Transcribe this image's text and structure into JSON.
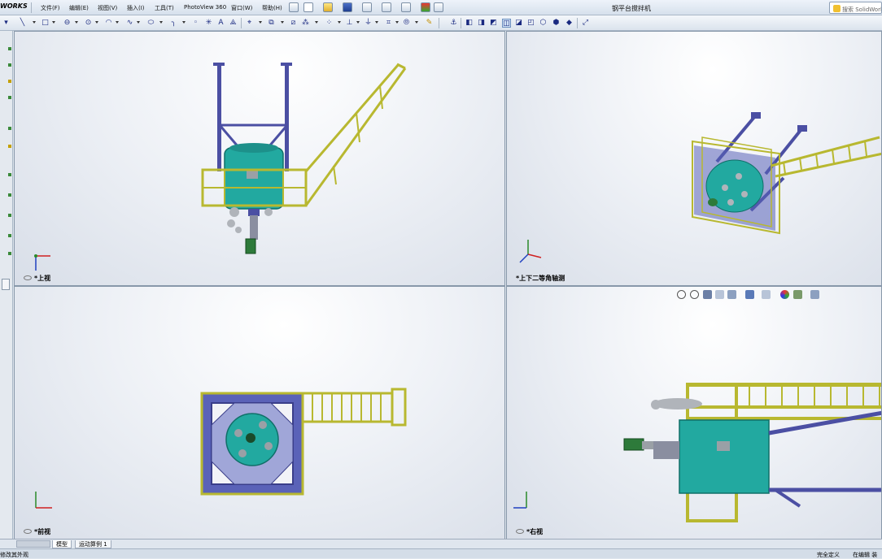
{
  "app": {
    "logo": "WORKS",
    "title": "钢平台搅拌机",
    "search_placeholder": "搜索 SolidWork"
  },
  "menu": [
    "文件(F)",
    "编辑(E)",
    "视图(V)",
    "插入(I)",
    "工具(T)",
    "PhotoView 360",
    "窗口(W)",
    "帮助(H)"
  ],
  "viewports": {
    "top_left": {
      "label": "*上视"
    },
    "top_right": {
      "label": "*上下二等角轴测"
    },
    "bottom_left": {
      "label": "*前视"
    },
    "bottom_right": {
      "label": "*右视"
    }
  },
  "tabs": [
    "模型",
    "运动算例 1"
  ],
  "status": {
    "left": "修改其外观",
    "state": "完全定义",
    "editing": "在编辑 装"
  },
  "colors": {
    "frame": "#4b4fa3",
    "railing": "#b8b830",
    "tank": "#22a9a0",
    "motor": "#2d7a3a",
    "grey": "#9aa0a6"
  }
}
